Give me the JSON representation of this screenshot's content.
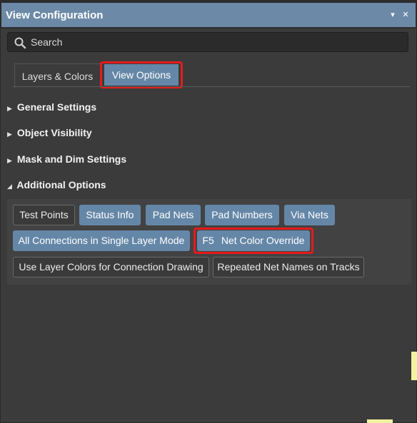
{
  "window": {
    "title": "View Configuration",
    "menu_glyph": "▾",
    "close_glyph": "✕"
  },
  "search": {
    "placeholder": "Search",
    "icon": "search-icon"
  },
  "tabs": [
    {
      "label": "Layers & Colors",
      "active": false
    },
    {
      "label": "View Options",
      "active": true
    }
  ],
  "sections": [
    {
      "label": "General Settings",
      "expanded": false
    },
    {
      "label": "Object Visibility",
      "expanded": false
    },
    {
      "label": "Mask and Dim Settings",
      "expanded": false
    },
    {
      "label": "Additional Options",
      "expanded": true
    }
  ],
  "carets": {
    "collapsed": "▶",
    "expanded": "◢"
  },
  "options": {
    "test_points": {
      "label": "Test Points",
      "on": false
    },
    "status_info": {
      "label": "Status Info",
      "on": true
    },
    "pad_nets": {
      "label": "Pad Nets",
      "on": true
    },
    "pad_numbers": {
      "label": "Pad Numbers",
      "on": true
    },
    "via_nets": {
      "label": "Via Nets",
      "on": true
    },
    "all_connections": {
      "label": "All Connections in Single Layer Mode",
      "on": true
    },
    "net_color_override": {
      "key": "F5",
      "label": "Net Color Override",
      "on": true
    },
    "use_layer_colors": {
      "label": "Use Layer Colors for Connection Drawing",
      "on": false
    },
    "repeated_net_names": {
      "label": "Repeated Net Names on Tracks",
      "on": false
    }
  },
  "colors": {
    "accent": "#6587a7",
    "titlebar": "#6c8aa7",
    "highlight": "#e51b1b",
    "background": "#3b3b3b"
  }
}
